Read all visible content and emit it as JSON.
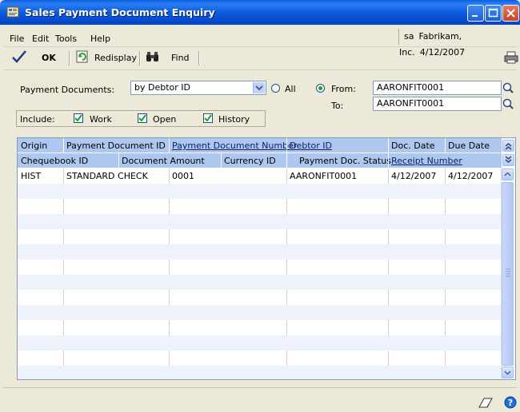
{
  "window": {
    "title": "Sales Payment Document Enquiry"
  },
  "menu": {
    "file": "File",
    "edit": "Edit",
    "tools": "Tools",
    "help": "Help"
  },
  "context": {
    "user": "sa",
    "company": "Fabrikam, Inc.",
    "date": "4/12/2007"
  },
  "toolbar": {
    "ok": "OK",
    "redisplay": "Redisplay",
    "find": "Find"
  },
  "form": {
    "payment_documents_label": "Payment Documents:",
    "sort_by": "by Debtor ID",
    "all_label": "All",
    "from_label": "From:",
    "to_label": "To:",
    "from_value": "AARONFIT0001",
    "to_value": "AARONFIT0001",
    "include_label": "Include:",
    "work_label": "Work",
    "open_label": "Open",
    "history_label": "History",
    "range_selected": "From",
    "work_checked": true,
    "open_checked": true,
    "history_checked": true
  },
  "grid": {
    "header_row1": [
      "Origin",
      "Payment Document ID",
      "Payment Document Number",
      "Debtor ID",
      "Doc. Date",
      "Due Date"
    ],
    "header_row2": [
      "Chequebook ID",
      "Document Amount",
      "Currency ID",
      "Payment Doc. Status",
      "Receipt Number"
    ],
    "rows": [
      {
        "origin": "HIST",
        "payment_document_id": "STANDARD CHECK",
        "payment_document_number": "0001",
        "debtor_id": "AARONFIT0001",
        "doc_date": "4/12/2007",
        "due_date": "4/12/2007"
      }
    ]
  },
  "colors": {
    "title_bar": "#0a58d8",
    "grid_header": "#aec7ee",
    "window_bg": "#ece9d8"
  }
}
